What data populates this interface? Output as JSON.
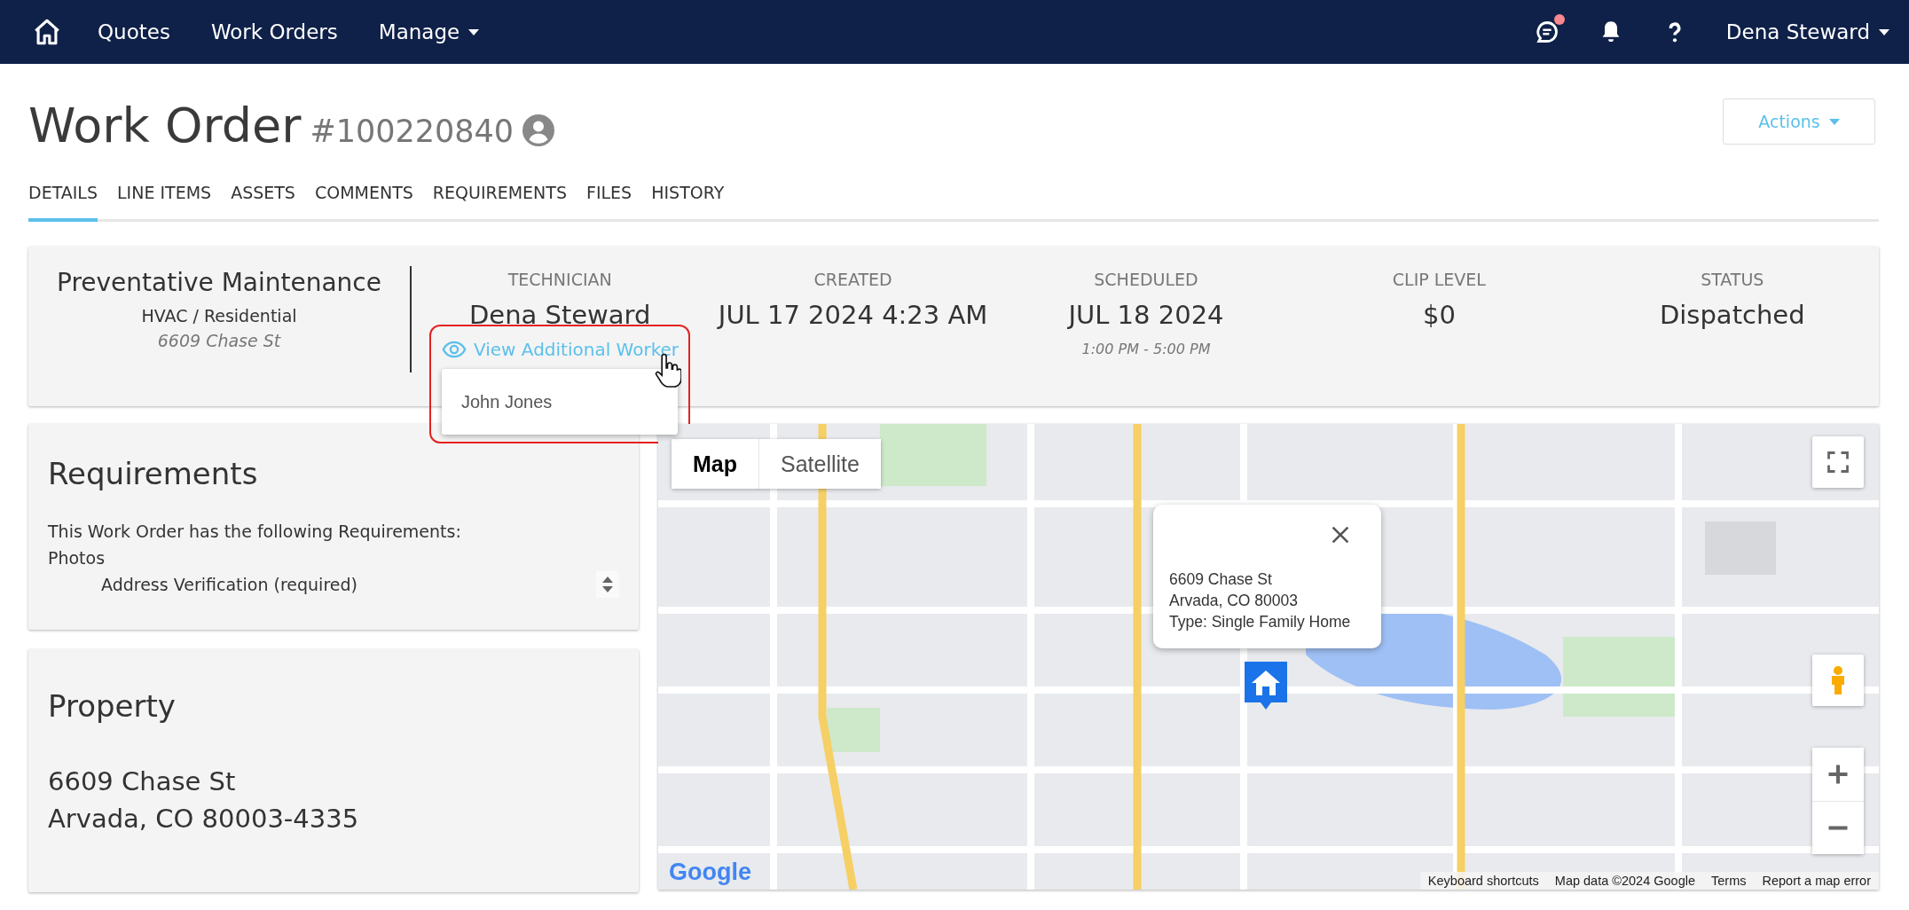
{
  "nav": {
    "items": [
      {
        "label": "Quotes",
        "dropdown": false
      },
      {
        "label": "Work Orders",
        "dropdown": false
      },
      {
        "label": "Manage",
        "dropdown": true
      }
    ],
    "chat_unread": true,
    "user": "Dena Steward"
  },
  "header": {
    "title": "Work Order",
    "number": "#100220840",
    "actions": "Actions"
  },
  "tabs": [
    {
      "label": "DETAILS",
      "selected": true
    },
    {
      "label": "LINE ITEMS",
      "selected": false
    },
    {
      "label": "ASSETS",
      "selected": false
    },
    {
      "label": "COMMENTS",
      "selected": false
    },
    {
      "label": "REQUIREMENTS",
      "selected": false
    },
    {
      "label": "FILES",
      "selected": false
    },
    {
      "label": "HISTORY",
      "selected": false
    }
  ],
  "summary": {
    "type": "Preventative Maintenance",
    "category": "HVAC / Residential",
    "address": "6609 Chase St",
    "fields": [
      {
        "label": "TECHNICIAN",
        "value": "Dena Steward"
      },
      {
        "label": "CREATED",
        "value": "JUL 17 2024 4:23 AM"
      },
      {
        "label": "SCHEDULED",
        "value": "JUL 18 2024",
        "note": "1:00 PM - 5:00 PM"
      },
      {
        "label": "CLIP LEVEL",
        "value": "$0"
      },
      {
        "label": "STATUS",
        "value": "Dispatched"
      }
    ],
    "additional_worker_link": "View Additional Worker",
    "additional_workers": [
      "John Jones"
    ]
  },
  "requirements": {
    "title": "Requirements",
    "intro": "This Work Order has the following Requirements:",
    "groups": [
      {
        "name": "Photos",
        "items": [
          "Address Verification (required)"
        ]
      }
    ]
  },
  "property": {
    "title": "Property",
    "lines": [
      "6609 Chase St",
      "Arvada, CO 80003-4335"
    ]
  },
  "map": {
    "types": [
      {
        "label": "Map",
        "selected": true
      },
      {
        "label": "Satellite",
        "selected": false
      }
    ],
    "info": [
      "6609 Chase St",
      "Arvada, CO 80003",
      "Type: Single Family Home"
    ],
    "logo": "Google",
    "footer": [
      "Keyboard shortcuts",
      "Map data ©2024 Google",
      "Terms",
      "Report a map error"
    ]
  }
}
